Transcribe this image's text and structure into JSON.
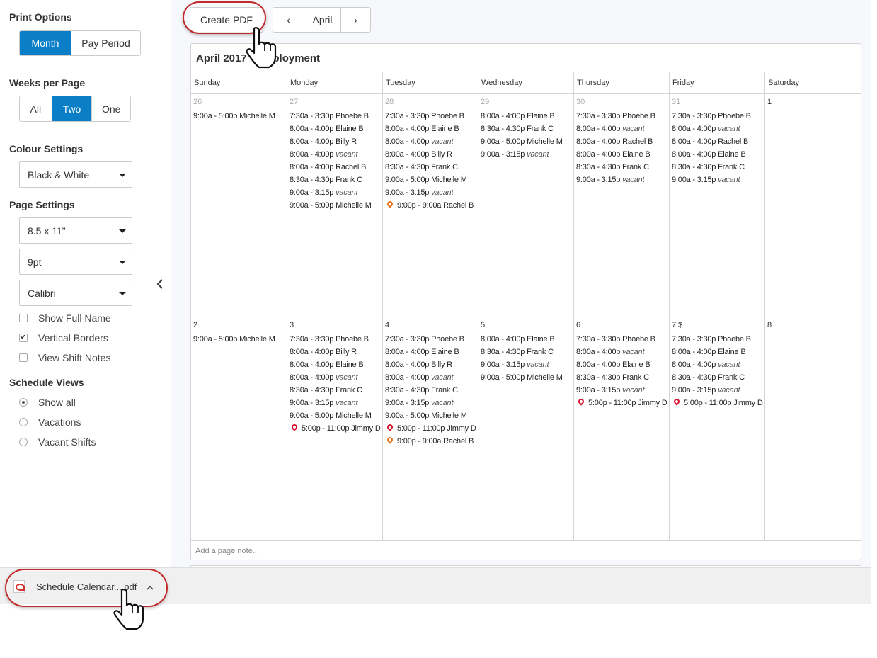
{
  "sidebar": {
    "print_options": {
      "title": "Print Options",
      "options": [
        "Month",
        "Pay Period"
      ],
      "selected": "Month"
    },
    "weeks_per_page": {
      "title": "Weeks per Page",
      "options": [
        "All",
        "Two",
        "One"
      ],
      "selected": "Two"
    },
    "colour_settings": {
      "title": "Colour Settings",
      "value": "Black & White"
    },
    "page_settings": {
      "title": "Page Settings",
      "paper_size": "8.5 x 11\"",
      "font_size": "9pt",
      "font": "Calibri",
      "checkboxes": [
        {
          "label": "Show Full Name",
          "checked": false
        },
        {
          "label": "Vertical Borders",
          "checked": true
        },
        {
          "label": "View Shift Notes",
          "checked": false
        }
      ]
    },
    "schedule_views": {
      "title": "Schedule Views",
      "options": [
        {
          "label": "Show all",
          "selected": true
        },
        {
          "label": "Vacations",
          "selected": false
        },
        {
          "label": "Vacant Shifts",
          "selected": false
        }
      ]
    },
    "collapse_icon": "chevron-left-icon"
  },
  "toolbar": {
    "create_pdf_label": "Create PDF",
    "prev_label": "‹",
    "month_label": "April",
    "next_label": "›"
  },
  "calendar": {
    "title": "April 2017 - Employment",
    "days": [
      "Sunday",
      "Monday",
      "Tuesday",
      "Wednesday",
      "Thursday",
      "Friday",
      "Saturday"
    ],
    "weeks": [
      [
        {
          "date": "26",
          "dim": true,
          "shifts": [
            {
              "time": "9:00a - 5:00p",
              "name": "Michelle M"
            }
          ]
        },
        {
          "date": "27",
          "dim": true,
          "shifts": [
            {
              "time": "7:30a - 3:30p",
              "name": "Phoebe B"
            },
            {
              "time": "8:00a - 4:00p",
              "name": "Elaine B"
            },
            {
              "time": "8:00a - 4:00p",
              "name": "Billy R"
            },
            {
              "time": "8:00a - 4:00p",
              "name": "vacant",
              "vacant": true
            },
            {
              "time": "8:00a - 4:00p",
              "name": "Rachel B"
            },
            {
              "time": "8:30a - 4:30p",
              "name": "Frank C"
            },
            {
              "time": "9:00a - 3:15p",
              "name": "vacant",
              "vacant": true
            },
            {
              "time": "9:00a - 5:00p",
              "name": "Michelle M"
            }
          ]
        },
        {
          "date": "28",
          "dim": true,
          "shifts": [
            {
              "time": "7:30a - 3:30p",
              "name": "Phoebe B"
            },
            {
              "time": "8:00a - 4:00p",
              "name": "Elaine B"
            },
            {
              "time": "8:00a - 4:00p",
              "name": "vacant",
              "vacant": true
            },
            {
              "time": "8:00a - 4:00p",
              "name": "Billy R"
            },
            {
              "time": "8:30a - 4:30p",
              "name": "Frank C"
            },
            {
              "time": "9:00a - 5:00p",
              "name": "Michelle M"
            },
            {
              "time": "9:00a - 3:15p",
              "name": "vacant",
              "vacant": true
            },
            {
              "time": "9:00p - 9:00a",
              "name": "Rachel B",
              "pin": "orange"
            }
          ]
        },
        {
          "date": "29",
          "dim": true,
          "shifts": [
            {
              "time": "8:00a - 4:00p",
              "name": "Elaine B"
            },
            {
              "time": "8:30a - 4:30p",
              "name": "Frank C"
            },
            {
              "time": "9:00a - 5:00p",
              "name": "Michelle M"
            },
            {
              "time": "9:00a - 3:15p",
              "name": "vacant",
              "vacant": true
            }
          ]
        },
        {
          "date": "30",
          "dim": true,
          "shifts": [
            {
              "time": "7:30a - 3:30p",
              "name": "Phoebe B"
            },
            {
              "time": "8:00a - 4:00p",
              "name": "vacant",
              "vacant": true
            },
            {
              "time": "8:00a - 4:00p",
              "name": "Rachel B"
            },
            {
              "time": "8:00a - 4:00p",
              "name": "Elaine B"
            },
            {
              "time": "8:30a - 4:30p",
              "name": "Frank C"
            },
            {
              "time": "9:00a - 3:15p",
              "name": "vacant",
              "vacant": true
            }
          ]
        },
        {
          "date": "31",
          "dim": true,
          "shifts": [
            {
              "time": "7:30a - 3:30p",
              "name": "Phoebe B"
            },
            {
              "time": "8:00a - 4:00p",
              "name": "vacant",
              "vacant": true
            },
            {
              "time": "8:00a - 4:00p",
              "name": "Rachel B"
            },
            {
              "time": "8:00a - 4:00p",
              "name": "Elaine B"
            },
            {
              "time": "8:30a - 4:30p",
              "name": "Frank C"
            },
            {
              "time": "9:00a - 3:15p",
              "name": "vacant",
              "vacant": true
            }
          ]
        },
        {
          "date": "1",
          "dim": false,
          "shifts": []
        }
      ],
      [
        {
          "date": "2",
          "dim": false,
          "shifts": [
            {
              "time": "9:00a - 5:00p",
              "name": "Michelle M"
            }
          ]
        },
        {
          "date": "3",
          "dim": false,
          "shifts": [
            {
              "time": "7:30a - 3:30p",
              "name": "Phoebe B"
            },
            {
              "time": "8:00a - 4:00p",
              "name": "Billy R"
            },
            {
              "time": "8:00a - 4:00p",
              "name": "Elaine B"
            },
            {
              "time": "8:00a - 4:00p",
              "name": "vacant",
              "vacant": true
            },
            {
              "time": "8:30a - 4:30p",
              "name": "Frank C"
            },
            {
              "time": "9:00a - 3:15p",
              "name": "vacant",
              "vacant": true
            },
            {
              "time": "9:00a - 5:00p",
              "name": "Michelle M"
            },
            {
              "time": "5:00p - 11:00p",
              "name": "Jimmy D",
              "pin": "red"
            }
          ]
        },
        {
          "date": "4",
          "dim": false,
          "shifts": [
            {
              "time": "7:30a - 3:30p",
              "name": "Phoebe B"
            },
            {
              "time": "8:00a - 4:00p",
              "name": "Elaine B"
            },
            {
              "time": "8:00a - 4:00p",
              "name": "Billy R"
            },
            {
              "time": "8:00a - 4:00p",
              "name": "vacant",
              "vacant": true
            },
            {
              "time": "8:30a - 4:30p",
              "name": "Frank C"
            },
            {
              "time": "9:00a - 3:15p",
              "name": "vacant",
              "vacant": true
            },
            {
              "time": "9:00a - 5:00p",
              "name": "Michelle M"
            },
            {
              "time": "5:00p - 11:00p",
              "name": "Jimmy D",
              "pin": "red"
            },
            {
              "time": "9:00p - 9:00a",
              "name": "Rachel B",
              "pin": "orange"
            }
          ]
        },
        {
          "date": "5",
          "dim": false,
          "shifts": [
            {
              "time": "8:00a - 4:00p",
              "name": "Elaine B"
            },
            {
              "time": "8:30a - 4:30p",
              "name": "Frank C"
            },
            {
              "time": "9:00a - 3:15p",
              "name": "vacant",
              "vacant": true
            },
            {
              "time": "9:00a - 5:00p",
              "name": "Michelle M"
            }
          ]
        },
        {
          "date": "6",
          "dim": false,
          "shifts": [
            {
              "time": "7:30a - 3:30p",
              "name": "Phoebe B"
            },
            {
              "time": "8:00a - 4:00p",
              "name": "vacant",
              "vacant": true
            },
            {
              "time": "8:00a - 4:00p",
              "name": "Elaine B"
            },
            {
              "time": "8:30a - 4:30p",
              "name": "Frank C"
            },
            {
              "time": "9:00a - 3:15p",
              "name": "vacant",
              "vacant": true
            },
            {
              "time": "5:00p - 11:00p",
              "name": "Jimmy D",
              "pin": "red"
            }
          ]
        },
        {
          "date": "7 $",
          "dim": false,
          "shifts": [
            {
              "time": "7:30a - 3:30p",
              "name": "Phoebe B"
            },
            {
              "time": "8:00a - 4:00p",
              "name": "Elaine B"
            },
            {
              "time": "8:00a - 4:00p",
              "name": "vacant",
              "vacant": true
            },
            {
              "time": "8:30a - 4:30p",
              "name": "Frank C"
            },
            {
              "time": "9:00a - 3:15p",
              "name": "vacant",
              "vacant": true
            },
            {
              "time": "5:00p - 11:00p",
              "name": "Jimmy D",
              "pin": "red"
            }
          ]
        },
        {
          "date": "8",
          "dim": false,
          "shifts": []
        }
      ]
    ],
    "page_note_placeholder": "Add a page note..."
  },
  "download_bar": {
    "file_name": "Schedule Calendar....pdf",
    "file_icon": "pdf-file-icon",
    "expand_label": "^"
  },
  "colors": {
    "accent": "#0a7fc7",
    "highlight": "#c22a2a",
    "pin_red": "#d8102a",
    "pin_orange": "#e8731c"
  }
}
